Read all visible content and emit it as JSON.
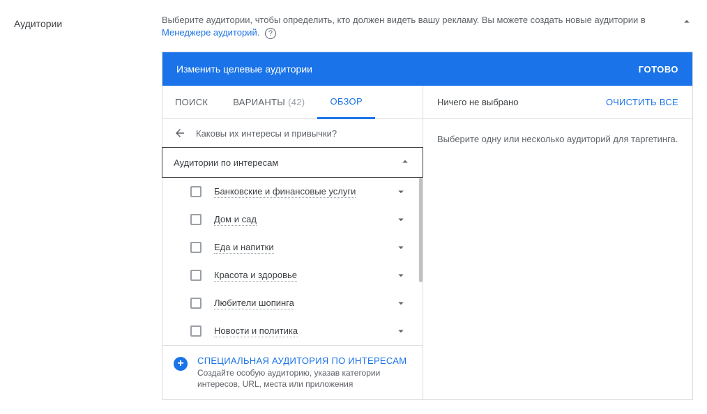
{
  "section_label": "Аудитории",
  "intro": {
    "text_a": "Выберите аудитории, чтобы определить, кто должен видеть вашу рекламу.  Вы можете создать новые аудитории в ",
    "link": "Менеджере аудиторий",
    "text_b": "."
  },
  "panel": {
    "title": "Изменить целевые аудитории",
    "done": "ГОТОВО"
  },
  "tabs": {
    "search": "ПОИСК",
    "ideas": "ВАРИАНТЫ",
    "ideas_count": "(42)",
    "browse": "ОБЗОР"
  },
  "breadcrumb": "Каковы их интересы и привычки?",
  "group_header": "Аудитории по интересам",
  "categories": [
    {
      "label": "Банковские и финансовые услуги"
    },
    {
      "label": "Дом и сад"
    },
    {
      "label": "Еда и напитки"
    },
    {
      "label": "Красота и здоровье"
    },
    {
      "label": "Любители шопинга"
    },
    {
      "label": "Новости и политика"
    }
  ],
  "custom": {
    "title": "СПЕЦИАЛЬНАЯ АУДИТОРИЯ ПО ИНТЕРЕСАМ",
    "subtitle": "Создайте особую аудиторию, указав категории интересов, URL, места или приложения"
  },
  "selected": {
    "none": "Ничего не выбрано",
    "clear": "ОЧИСТИТЬ ВСЕ",
    "empty": "Выберите одну или несколько аудиторий для таргетинга."
  }
}
